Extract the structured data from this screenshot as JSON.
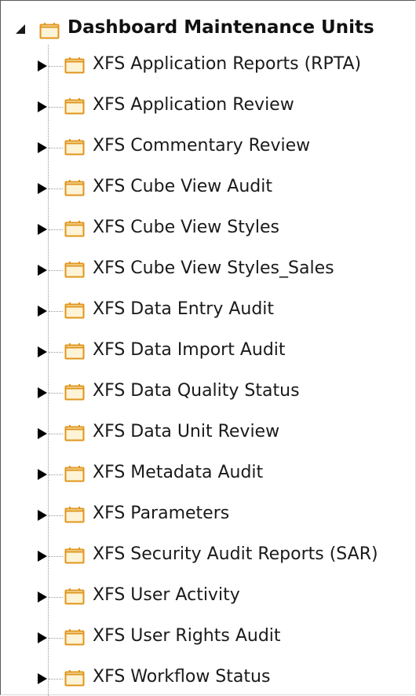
{
  "tree": {
    "root": {
      "label": "Dashboard Maintenance Units",
      "expanded": true,
      "icon": "folder-icon"
    },
    "children": [
      {
        "label": "XFS Application Reports (RPTA)",
        "icon": "folder-icon"
      },
      {
        "label": "XFS Application Review",
        "icon": "folder-icon"
      },
      {
        "label": "XFS Commentary Review",
        "icon": "folder-icon"
      },
      {
        "label": "XFS Cube View Audit",
        "icon": "folder-icon"
      },
      {
        "label": "XFS Cube View Styles",
        "icon": "folder-icon"
      },
      {
        "label": "XFS Cube View Styles_Sales",
        "icon": "folder-icon"
      },
      {
        "label": "XFS Data Entry Audit",
        "icon": "folder-icon"
      },
      {
        "label": "XFS Data Import Audit",
        "icon": "folder-icon"
      },
      {
        "label": "XFS Data Quality Status",
        "icon": "folder-icon"
      },
      {
        "label": "XFS Data Unit Review",
        "icon": "folder-icon"
      },
      {
        "label": "XFS Metadata Audit",
        "icon": "folder-icon"
      },
      {
        "label": "XFS Parameters",
        "icon": "folder-icon"
      },
      {
        "label": "XFS Security Audit Reports (SAR)",
        "icon": "folder-icon"
      },
      {
        "label": "XFS User Activity",
        "icon": "folder-icon"
      },
      {
        "label": "XFS User Rights Audit",
        "icon": "folder-icon"
      },
      {
        "label": "XFS Workflow Status",
        "icon": "folder-icon"
      }
    ]
  },
  "colors": {
    "folder_fill": "#fdf3d6",
    "folder_stroke": "#e0961b",
    "guide_line": "#9a9a9a",
    "text": "#1a1a1a"
  }
}
